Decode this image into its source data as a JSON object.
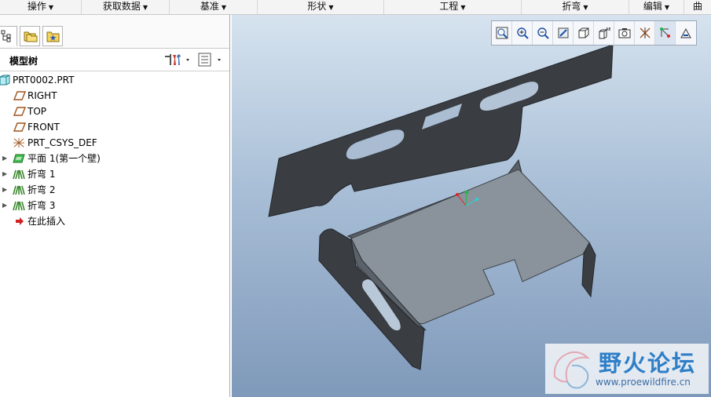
{
  "ribbon": [
    {
      "label": "操作"
    },
    {
      "label": "获取数据"
    },
    {
      "label": "基准"
    },
    {
      "label": "形状"
    },
    {
      "label": "工程"
    },
    {
      "label": "折弯"
    },
    {
      "label": "编辑"
    },
    {
      "label": "曲"
    }
  ],
  "model_tree": {
    "title": "模型树",
    "items": [
      {
        "label": "PRT0002.PRT",
        "icon": "part-icon"
      },
      {
        "label": "RIGHT",
        "icon": "datum-plane-icon"
      },
      {
        "label": "TOP",
        "icon": "datum-plane-icon"
      },
      {
        "label": "FRONT",
        "icon": "datum-plane-icon"
      },
      {
        "label": "PRT_CSYS_DEF",
        "icon": "csys-icon"
      },
      {
        "label": "平面 1(第一个壁)",
        "icon": "flat-wall-icon"
      },
      {
        "label": "折弯 1",
        "icon": "bend-icon"
      },
      {
        "label": "折弯 2",
        "icon": "bend-icon"
      },
      {
        "label": "折弯 3",
        "icon": "bend-icon"
      },
      {
        "label": "在此插入",
        "icon": "insert-here-icon"
      }
    ]
  },
  "watermark": {
    "name": "野火论坛",
    "url": "www.proewildfire.cn"
  },
  "colors": {
    "part_dark": "#3a3d42",
    "part_light": "#8a939c",
    "viewport_top": "#d6e3ef",
    "viewport_bottom": "#7f99ba"
  }
}
